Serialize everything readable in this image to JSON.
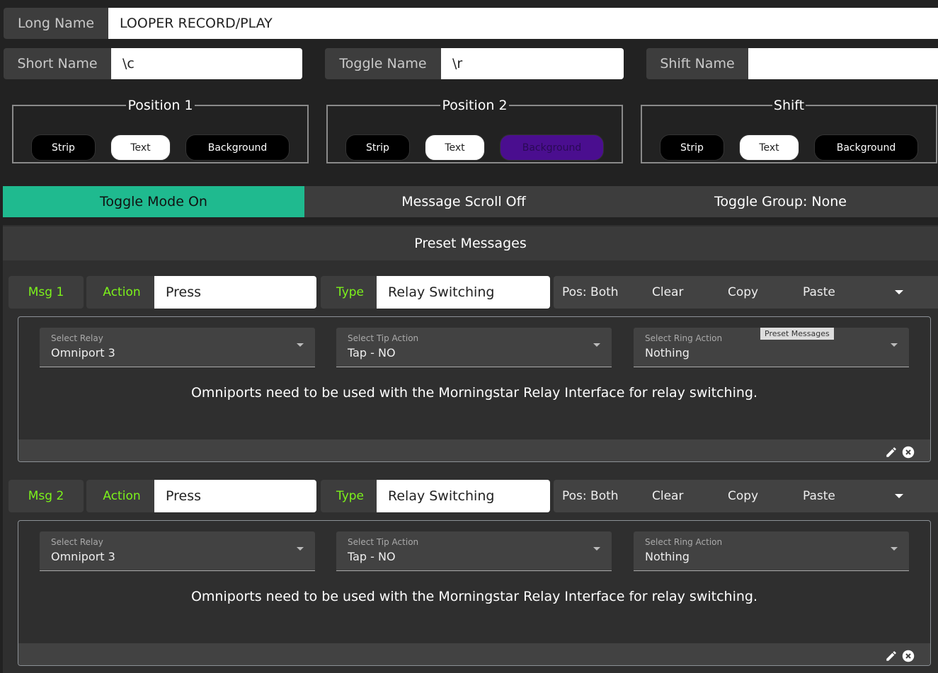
{
  "long_name": {
    "label": "Long Name",
    "value": "LOOPER RECORD/PLAY"
  },
  "short_name": {
    "label": "Short Name",
    "value": "\\c"
  },
  "toggle_name": {
    "label": "Toggle Name",
    "value": "\\r"
  },
  "shift_name": {
    "label": "Shift Name",
    "value": ""
  },
  "groups": [
    {
      "title": "Position 1",
      "strip": "Strip",
      "text": "Text",
      "background": "Background"
    },
    {
      "title": "Position 2",
      "strip": "Strip",
      "text": "Text",
      "background": "Background"
    },
    {
      "title": "Shift",
      "strip": "Strip",
      "text": "Text",
      "background": "Background"
    }
  ],
  "colors": {
    "accent": "#1fba8f",
    "label_green": "#7cf21b",
    "position2_background": "#4a0e8f"
  },
  "toggles": {
    "toggle_mode": "Toggle Mode On",
    "message_scroll": "Message Scroll Off",
    "toggle_group": "Toggle Group: None"
  },
  "preset_header": "Preset Messages",
  "tooltip": "Preset Messages",
  "messages": [
    {
      "msg": "Msg 1",
      "action_label": "Action",
      "action": "Press",
      "type_label": "Type",
      "type": "Relay Switching",
      "pos": "Pos: Both",
      "clear": "Clear",
      "copy": "Copy",
      "paste": "Paste",
      "relay_label": "Select Relay",
      "relay": "Omniport 3",
      "tip_label": "Select Tip Action",
      "tip": "Tap - NO",
      "ring_label": "Select Ring Action",
      "ring": "Nothing",
      "note": "Omniports need to be used with the Morningstar Relay Interface for relay switching."
    },
    {
      "msg": "Msg 2",
      "action_label": "Action",
      "action": "Press",
      "type_label": "Type",
      "type": "Relay Switching",
      "pos": "Pos: Both",
      "clear": "Clear",
      "copy": "Copy",
      "paste": "Paste",
      "relay_label": "Select Relay",
      "relay": "Omniport 3",
      "tip_label": "Select Tip Action",
      "tip": "Tap - NO",
      "ring_label": "Select Ring Action",
      "ring": "Nothing",
      "note": "Omniports need to be used with the Morningstar Relay Interface for relay switching."
    }
  ]
}
